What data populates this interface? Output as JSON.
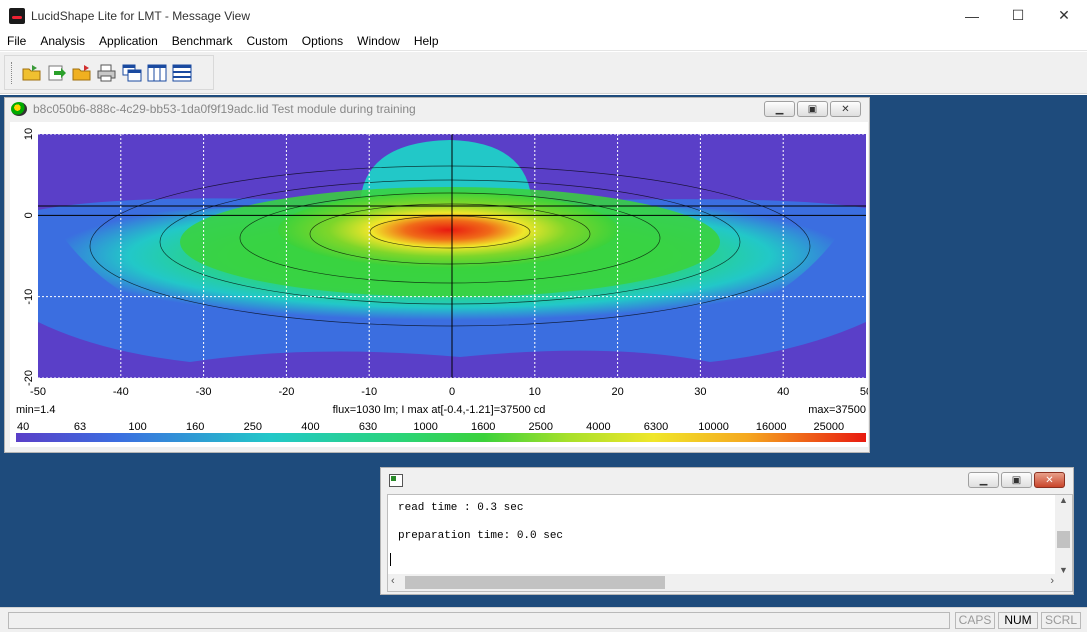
{
  "window": {
    "title": "LucidShape Lite for LMT - Message View",
    "minimize": "—",
    "maximize": "☐",
    "close": "✕"
  },
  "menu": [
    "File",
    "Analysis",
    "Application",
    "Benchmark",
    "Custom",
    "Options",
    "Window",
    "Help"
  ],
  "toolbar": {
    "buttons": [
      "open-folder-icon",
      "reload-icon",
      "open-folder-alt-icon",
      "print-icon",
      "cascade-windows-icon",
      "tile-vertical-icon",
      "tile-horizontal-icon"
    ]
  },
  "plot_window": {
    "title": "b8c050b6-888c-4c29-bb53-1da0f9f19adc.lid  Test module during training",
    "min_label": "min=1.4",
    "center_label": "flux=1030 lm; I max at[-0.4,-1.21]=37500 cd",
    "max_label": "max=37500",
    "colorbar_labels": [
      "40",
      "63",
      "100",
      "160",
      "250",
      "400",
      "630",
      "1000",
      "1600",
      "2500",
      "4000",
      "6300",
      "10000",
      "16000",
      "25000"
    ]
  },
  "chart_data": {
    "type": "heatmap",
    "xlabel": "",
    "ylabel": "",
    "x_ticks": [
      -50,
      -40,
      -30,
      -20,
      -10,
      0,
      10,
      20,
      30,
      40,
      50
    ],
    "y_ticks": [
      10,
      0,
      -10,
      -20
    ],
    "xlim": [
      -50,
      50
    ],
    "ylim": [
      -20,
      10
    ],
    "grid": true,
    "min_value": 1.4,
    "max_value": 37500,
    "max_location": [
      -0.4,
      -1.21
    ],
    "colorscale": [
      "#5a3fc8",
      "#3b6ee0",
      "#22c8c8",
      "#2ad47a",
      "#3bd23b",
      "#a8e02a",
      "#f0e62a",
      "#f5a820",
      "#ef5a1a",
      "#e81a10"
    ],
    "colorbar_levels": [
      40,
      63,
      100,
      160,
      250,
      400,
      630,
      1000,
      1600,
      2500,
      4000,
      6300,
      10000,
      16000,
      25000
    ]
  },
  "message_window": {
    "lines": [
      "read time : 0.3 sec",
      "",
      "preparation time: 0.0 sec"
    ]
  },
  "statusbar": {
    "caps": "CAPS",
    "num": "NUM",
    "scrl": "SCRL"
  }
}
